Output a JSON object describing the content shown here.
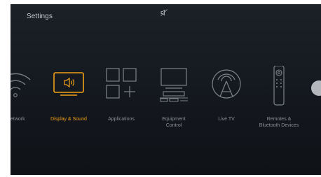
{
  "header": {
    "title": "Settings"
  },
  "status": {
    "icon": "mute-icon"
  },
  "tiles": [
    {
      "id": "network",
      "label": "etwork",
      "icon": "wifi-icon",
      "active": false
    },
    {
      "id": "display_sound",
      "label": "Display & Sound",
      "icon": "display-sound-icon",
      "active": true
    },
    {
      "id": "applications",
      "label": "Applications",
      "icon": "applications-icon",
      "active": false
    },
    {
      "id": "equipment_control",
      "label": "Equipment\nControl",
      "icon": "equipment-control-icon",
      "active": false
    },
    {
      "id": "live_tv",
      "label": "Live TV",
      "icon": "antenna-icon",
      "active": false
    },
    {
      "id": "remotes_bluetooth",
      "label": "Remotes &\nBluetooth Devices",
      "icon": "remote-icon",
      "active": false
    }
  ],
  "colors": {
    "background": "#151920",
    "accent": "#f0a016",
    "icon_gray": "#7e828a",
    "label_gray": "#8b8f96"
  }
}
